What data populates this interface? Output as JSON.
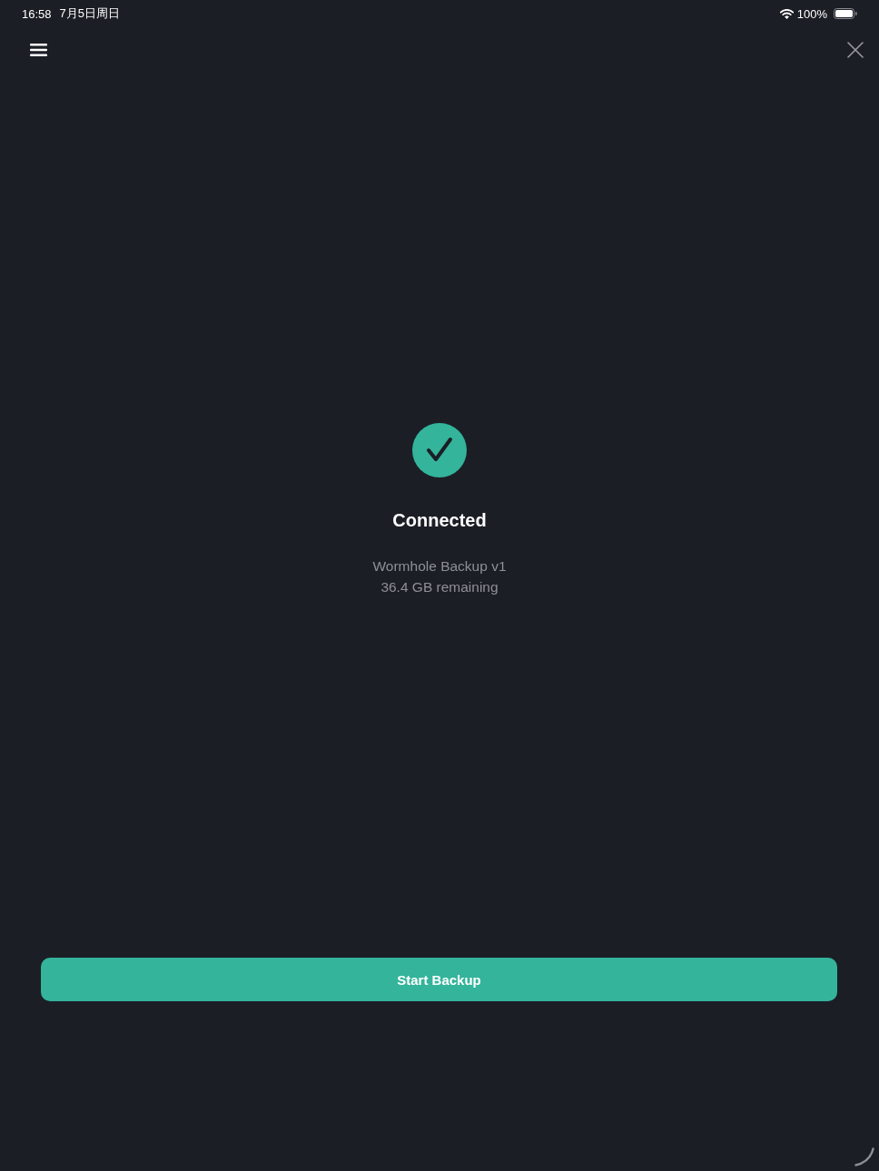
{
  "status_bar": {
    "time": "16:58",
    "date": "7月5日周日",
    "battery": "100%"
  },
  "status": {
    "title": "Connected",
    "lines": [
      "Wormhole Backup v1",
      "36.4 GB remaining"
    ]
  },
  "primary_button": {
    "label": "Start Backup"
  }
}
